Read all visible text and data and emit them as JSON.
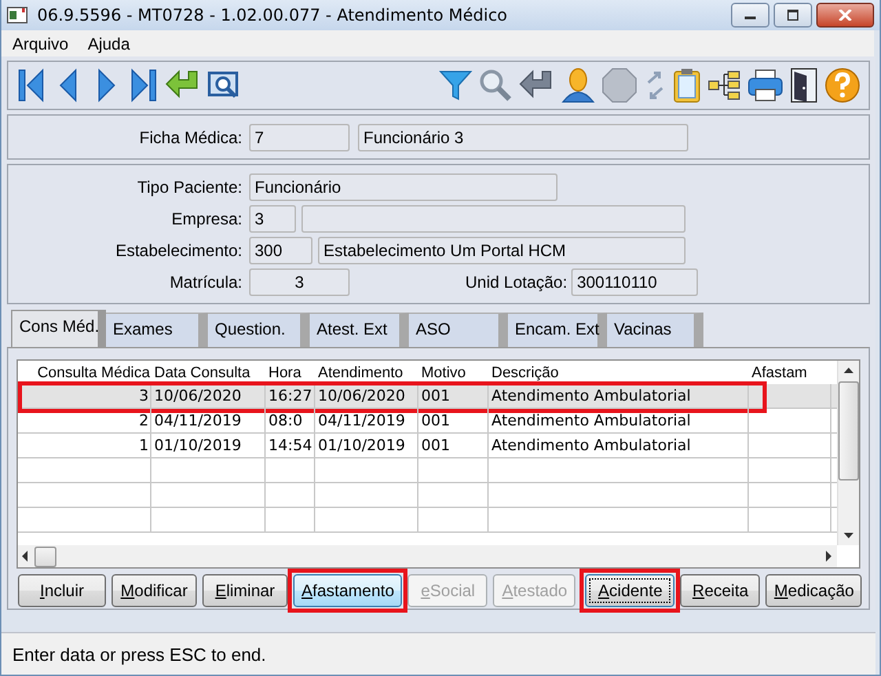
{
  "window": {
    "title": "06.9.5596 - MT0728 - 1.02.00.077 - Atendimento Médico"
  },
  "menu": [
    {
      "label": "Arquivo"
    },
    {
      "label": "Ajuda"
    }
  ],
  "header": [
    {
      "label": "Ficha Médica:",
      "fields": [
        {
          "value": "7"
        },
        {
          "value": "Funcionário 3"
        }
      ]
    }
  ],
  "details": [
    {
      "label": "Tipo Paciente:",
      "fields": [
        {
          "value": "Funcionário"
        }
      ]
    },
    {
      "label": "Empresa:",
      "fields": [
        {
          "value": "3"
        }
      ]
    },
    {
      "label": "Estabelecimento:",
      "fields": [
        {
          "value": "300"
        },
        {
          "value": "Estabelecimento Um Portal HCM"
        }
      ]
    },
    {
      "label": "Matrícula:",
      "fields": [
        {
          "value": "3"
        }
      ],
      "extra": {
        "label": "Unid Lotação:",
        "value": "300110110"
      }
    }
  ],
  "tabs": [
    {
      "label": "Cons Méd.",
      "selected": true
    },
    {
      "label": "Exames",
      "selected": false
    },
    {
      "label": "Question.",
      "selected": false
    },
    {
      "label": "Atest. Ext",
      "selected": false
    },
    {
      "label": "ASO",
      "selected": false
    },
    {
      "label": "Encam. Ext",
      "selected": false
    },
    {
      "label": "Vacinas",
      "selected": false
    }
  ],
  "table": {
    "columns": [
      "Consulta Médica",
      "Data Consulta",
      "Hora",
      "Atendimento",
      "Motivo",
      "Descrição",
      "Afastam"
    ],
    "rows": [
      {
        "cells": [
          "3",
          "10/06/2020",
          "16:27",
          "10/06/2020",
          "001",
          "Atendimento Ambulatorial"
        ],
        "selected": true,
        "highlighted": true
      },
      {
        "cells": [
          "2",
          "04/11/2019",
          "08:0",
          "04/11/2019",
          "001",
          "Atendimento Ambulatorial"
        ],
        "selected": false,
        "highlighted": false
      },
      {
        "cells": [
          "1",
          "01/10/2019",
          "14:54",
          "01/10/2019",
          "001",
          "Atendimento Ambulatorial"
        ],
        "selected": false,
        "highlighted": false
      }
    ]
  },
  "buttons": [
    {
      "label": "Incluir",
      "disabled": false,
      "hovered": false,
      "focused": false,
      "highlighted": false
    },
    {
      "label": "Modificar",
      "disabled": false,
      "hovered": false,
      "focused": false,
      "highlighted": false
    },
    {
      "label": "Eliminar",
      "disabled": false,
      "hovered": false,
      "focused": false,
      "highlighted": false
    },
    {
      "label": "Afastamento",
      "disabled": false,
      "hovered": true,
      "focused": false,
      "highlighted": true
    },
    {
      "label": "eSocial",
      "disabled": true,
      "hovered": false,
      "focused": false,
      "highlighted": false
    },
    {
      "label": "Atestado",
      "disabled": true,
      "hovered": false,
      "focused": false,
      "highlighted": false
    },
    {
      "label": "Acidente",
      "disabled": false,
      "hovered": false,
      "focused": true,
      "highlighted": true
    },
    {
      "label": "Receita",
      "disabled": false,
      "hovered": false,
      "focused": false,
      "highlighted": false
    },
    {
      "label": "Medicação",
      "disabled": false,
      "hovered": false,
      "focused": false,
      "highlighted": false
    }
  ],
  "status_bar": {
    "text": "Enter data or press ESC to end."
  }
}
